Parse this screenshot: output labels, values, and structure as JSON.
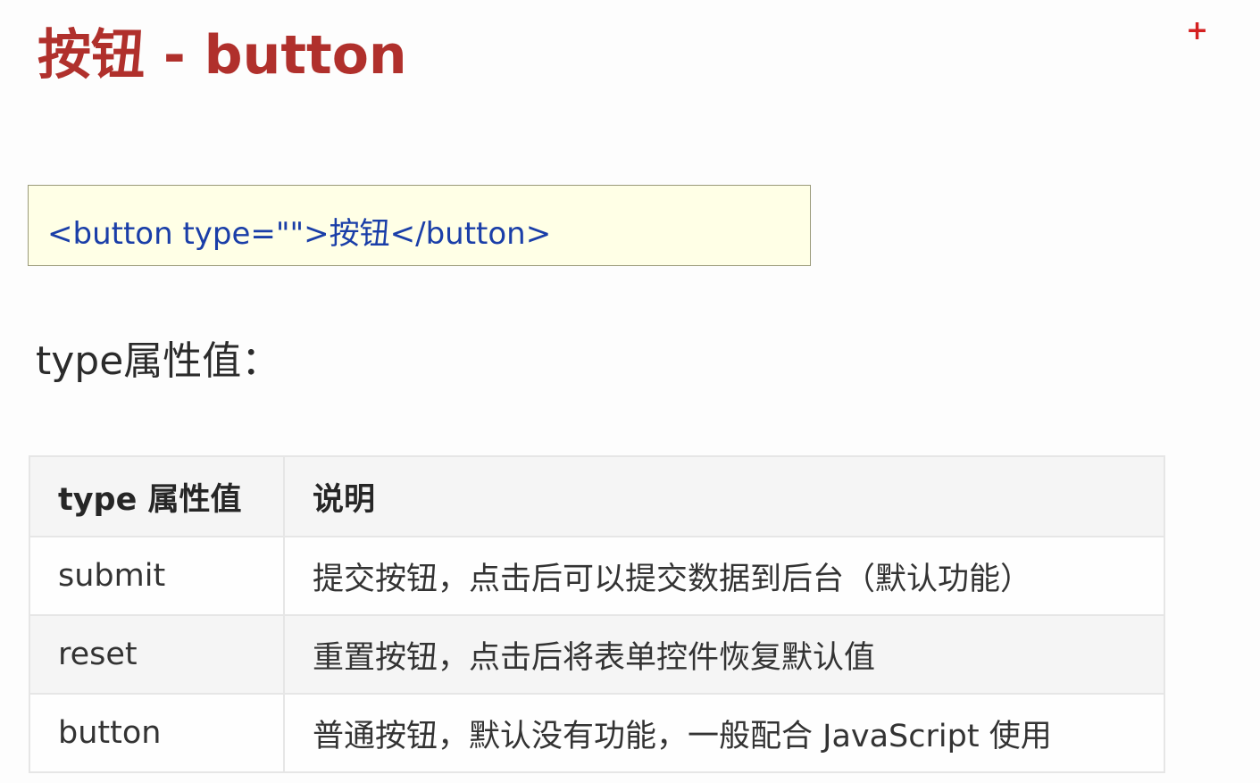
{
  "title": "按钮 - button",
  "plus_icon": "+",
  "code": "<button type=\"\">按钮</button>",
  "subtitle": "type属性值：",
  "table": {
    "headers": [
      "type 属性值",
      "说明"
    ],
    "rows": [
      [
        "submit",
        "提交按钮，点击后可以提交数据到后台（默认功能）"
      ],
      [
        "reset",
        "重置按钮，点击后将表单控件恢复默认值"
      ],
      [
        "button",
        "普通按钮，默认没有功能，一般配合 JavaScript 使用"
      ]
    ]
  },
  "colors": {
    "title": "#b0302c",
    "code_text": "#1a3ea8",
    "code_background": "#ffffe6"
  }
}
